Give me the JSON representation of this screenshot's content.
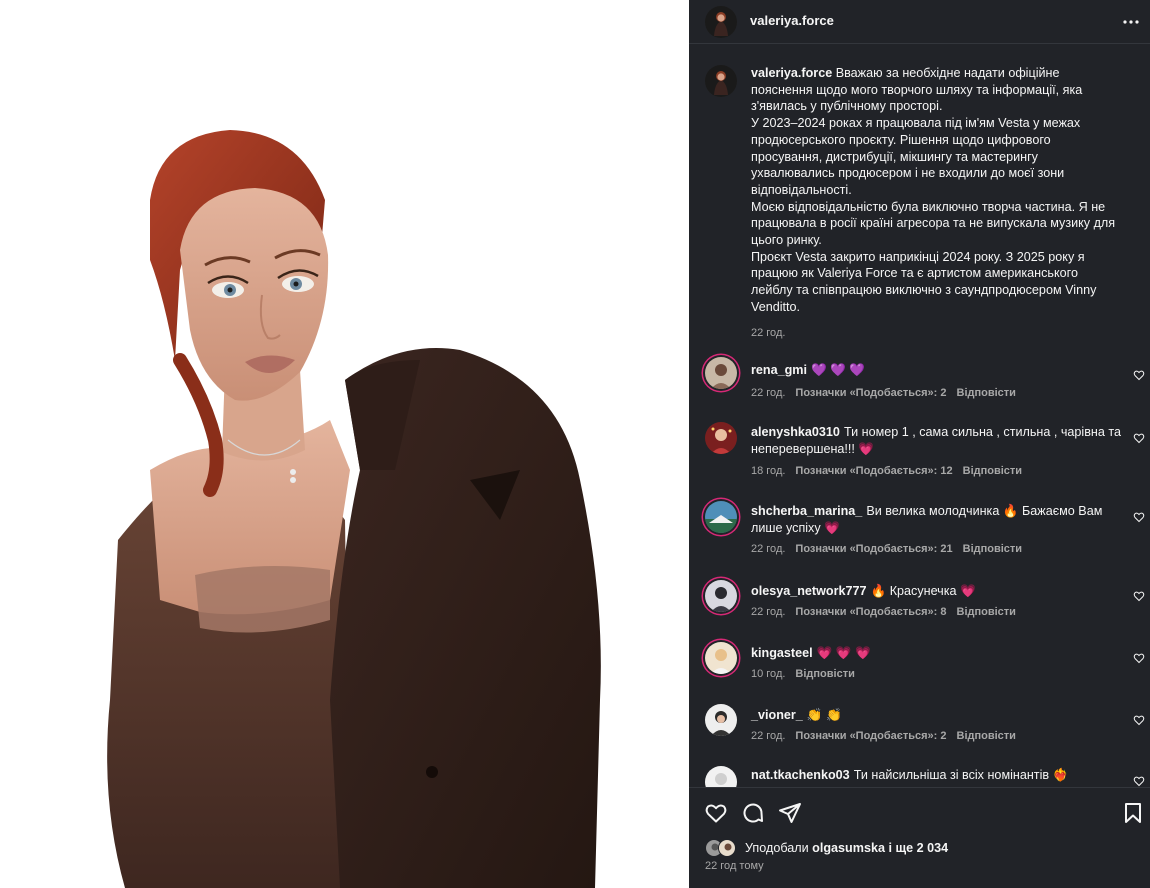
{
  "post": {
    "author": "valeriya.force",
    "caption_lines": [
      {
        "user": "valeriya.force",
        "text": "Вважаю за необхідне надати офіційне"
      },
      {
        "text": "пояснення щодо мого творчого шляху та інформації, яка"
      },
      {
        "text": "з'явилась у публічному просторі."
      },
      {
        "text": "У 2023–2024 роках я працювала під ім'ям Vesta у межах"
      },
      {
        "text": "продюсерського проєкту. Рішення щодо цифрового"
      },
      {
        "text": "просування, дистрибуції, мікшингу та мастерингу"
      },
      {
        "text": "ухвалювались продюсером і не входили до моєї зони"
      },
      {
        "text": "відповідальності."
      },
      {
        "text": "Моєю відповідальністю була виключно творча частина. Я не"
      },
      {
        "text": "працювала в росії країні агресора та не випускала музику для"
      },
      {
        "text": "цього ринку."
      },
      {
        "text": "Проєкт Vesta закрито наприкінці 2024 року. З 2025 року я"
      },
      {
        "text": "працюю як Valeriya Force та є артистом американського"
      },
      {
        "text": "лейблу та співпрацюю виключно з саундпродюсером Vinny"
      },
      {
        "text": "Venditto."
      }
    ],
    "caption_time": "22 год.",
    "likes_prefix": "Уподобали",
    "likes_user": "olgasumska",
    "likes_suffix": "і ще 2 034",
    "post_time": "22 год тому"
  },
  "comments": [
    {
      "user": "rena_gmi",
      "text": "💜 💜 💜",
      "time": "22 год.",
      "likes": "Позначки «Подобається»: 2",
      "reply": "Відповісти"
    },
    {
      "user": "alenyshka0310",
      "text": "Ти номер 1 , сама сильна , стильна , чарівна та неперевершена!!! 💗",
      "time": "18 год.",
      "likes": "Позначки «Подобається»: 12",
      "reply": "Відповісти"
    },
    {
      "user": "shcherba_marina_",
      "text": "Ви велика молодчинка 🔥 Бажаємо Вам лише успіху 💗",
      "time": "22 год.",
      "likes": "Позначки «Подобається»: 21",
      "reply": "Відповісти"
    },
    {
      "user": "olesya_network777",
      "text": "🔥 Красунечка 💗",
      "time": "22 год.",
      "likes": "Позначки «Подобається»: 8",
      "reply": "Відповісти"
    },
    {
      "user": "kingasteel",
      "text": "💗 💗 💗",
      "time": "10 год.",
      "likes": "",
      "reply": "Відповісти"
    },
    {
      "user": "_vioner_",
      "text": "👏 👏",
      "time": "22 год.",
      "likes": "Позначки «Подобається»: 2",
      "reply": "Відповісти"
    },
    {
      "user": "nat.tkachenko03",
      "text": "Ти найсильніша зі всіх номінантів ❤️‍🔥",
      "time": "",
      "likes": "",
      "reply": ""
    }
  ],
  "icons": {
    "header_more": "more-horizontal-icon",
    "like": "heart-icon",
    "comment": "comment-icon",
    "share": "share-icon",
    "save": "bookmark-icon"
  },
  "colors": {
    "panel_bg": "#212328",
    "text_primary": "#f5f5f5",
    "text_secondary": "#a8a8a8",
    "story_ring": "#d62976"
  }
}
